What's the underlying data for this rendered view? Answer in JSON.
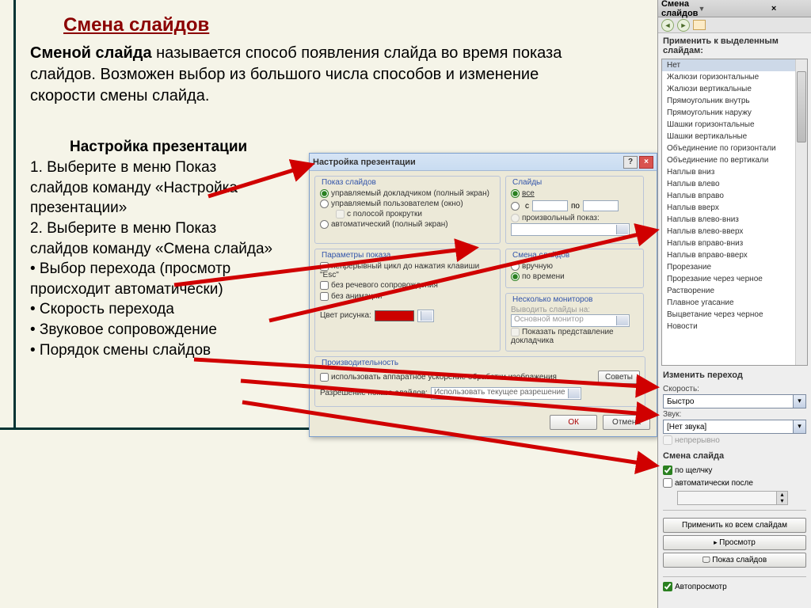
{
  "slide": {
    "title": "Смена слайдов",
    "desc_bold": "Сменой слайда",
    "desc_rest": " называется способ появления слайда во время показа слайдов. Возможен выбор из большого числа способов и изменение скорости смены слайда.",
    "subtitle": "Настройка презентации",
    "step1": "1. Выберите в меню Показ слайдов команду «Настройка презентации»",
    "step2": "2. Выберите в меню Показ слайдов команду «Смена слайда»",
    "bullet1": "• Выбор перехода (просмотр происходит автоматически)",
    "bullet2": "• Скорость перехода",
    "bullet3": "• Звуковое сопровождение",
    "bullet4": "• Порядок смены слайдов"
  },
  "dialog": {
    "title": "Настройка презентации",
    "fs_show": "Показ слайдов",
    "show_opt1": "управляемый докладчиком (полный экран)",
    "show_opt2": "управляемый пользователем (окно)",
    "show_scroll": "с полосой прокрутки",
    "show_opt3": "автоматический (полный экран)",
    "fs_slides": "Слайды",
    "slides_all": "все",
    "slides_from": "с",
    "slides_to": "по",
    "slides_custom": "произвольный показ:",
    "fs_params": "Параметры показа",
    "param1": "непрерывный цикл до нажатия клавиши \"Esc\"",
    "param2": "без речевого сопровождения",
    "param3": "без анимации",
    "param_color": "Цвет рисунка:",
    "fs_trans": "Смена слайдов",
    "trans_manual": "вручную",
    "trans_time": "по времени",
    "fs_mon": "Несколько мониторов",
    "mon_label": "Выводить слайды на:",
    "mon_val": "Основной монитор",
    "mon_chk": "Показать представление докладчика",
    "fs_perf": "Производительность",
    "perf_chk": "использовать аппаратное ускорение обработки изображения",
    "perf_tip": "Советы",
    "perf_res": "Разрешение показа слайдов:",
    "perf_res_val": "Использовать текущее разрешение",
    "ok": "ОК",
    "cancel": "Отмена"
  },
  "panel": {
    "title": "Смена слайдов",
    "apply_label": "Применить к выделенным слайдам:",
    "items": [
      "Нет",
      "Жалюзи горизонтальные",
      "Жалюзи вертикальные",
      "Прямоугольник внутрь",
      "Прямоугольник наружу",
      "Шашки горизонтальные",
      "Шашки вертикальные",
      "Объединение по горизонтали",
      "Объединение по вертикали",
      "Наплыв вниз",
      "Наплыв влево",
      "Наплыв вправо",
      "Наплыв вверх",
      "Наплыв влево-вниз",
      "Наплыв влево-вверх",
      "Наплыв вправо-вниз",
      "Наплыв вправо-вверх",
      "Прорезание",
      "Прорезание через черное",
      "Растворение",
      "Плавное угасание",
      "Выцветание через черное",
      "Новости"
    ],
    "change_title": "Изменить переход",
    "speed_label": "Скорость:",
    "speed_val": "Быстро",
    "sound_label": "Звук:",
    "sound_val": "[Нет звука]",
    "loop": "непрерывно",
    "slide_change_title": "Смена слайда",
    "by_click": "по щелчку",
    "auto_after": "автоматически после",
    "apply_all": "Применить ко всем слайдам",
    "preview": "Просмотр",
    "slideshow": "Показ слайдов",
    "autopreview": "Автопросмотр"
  }
}
